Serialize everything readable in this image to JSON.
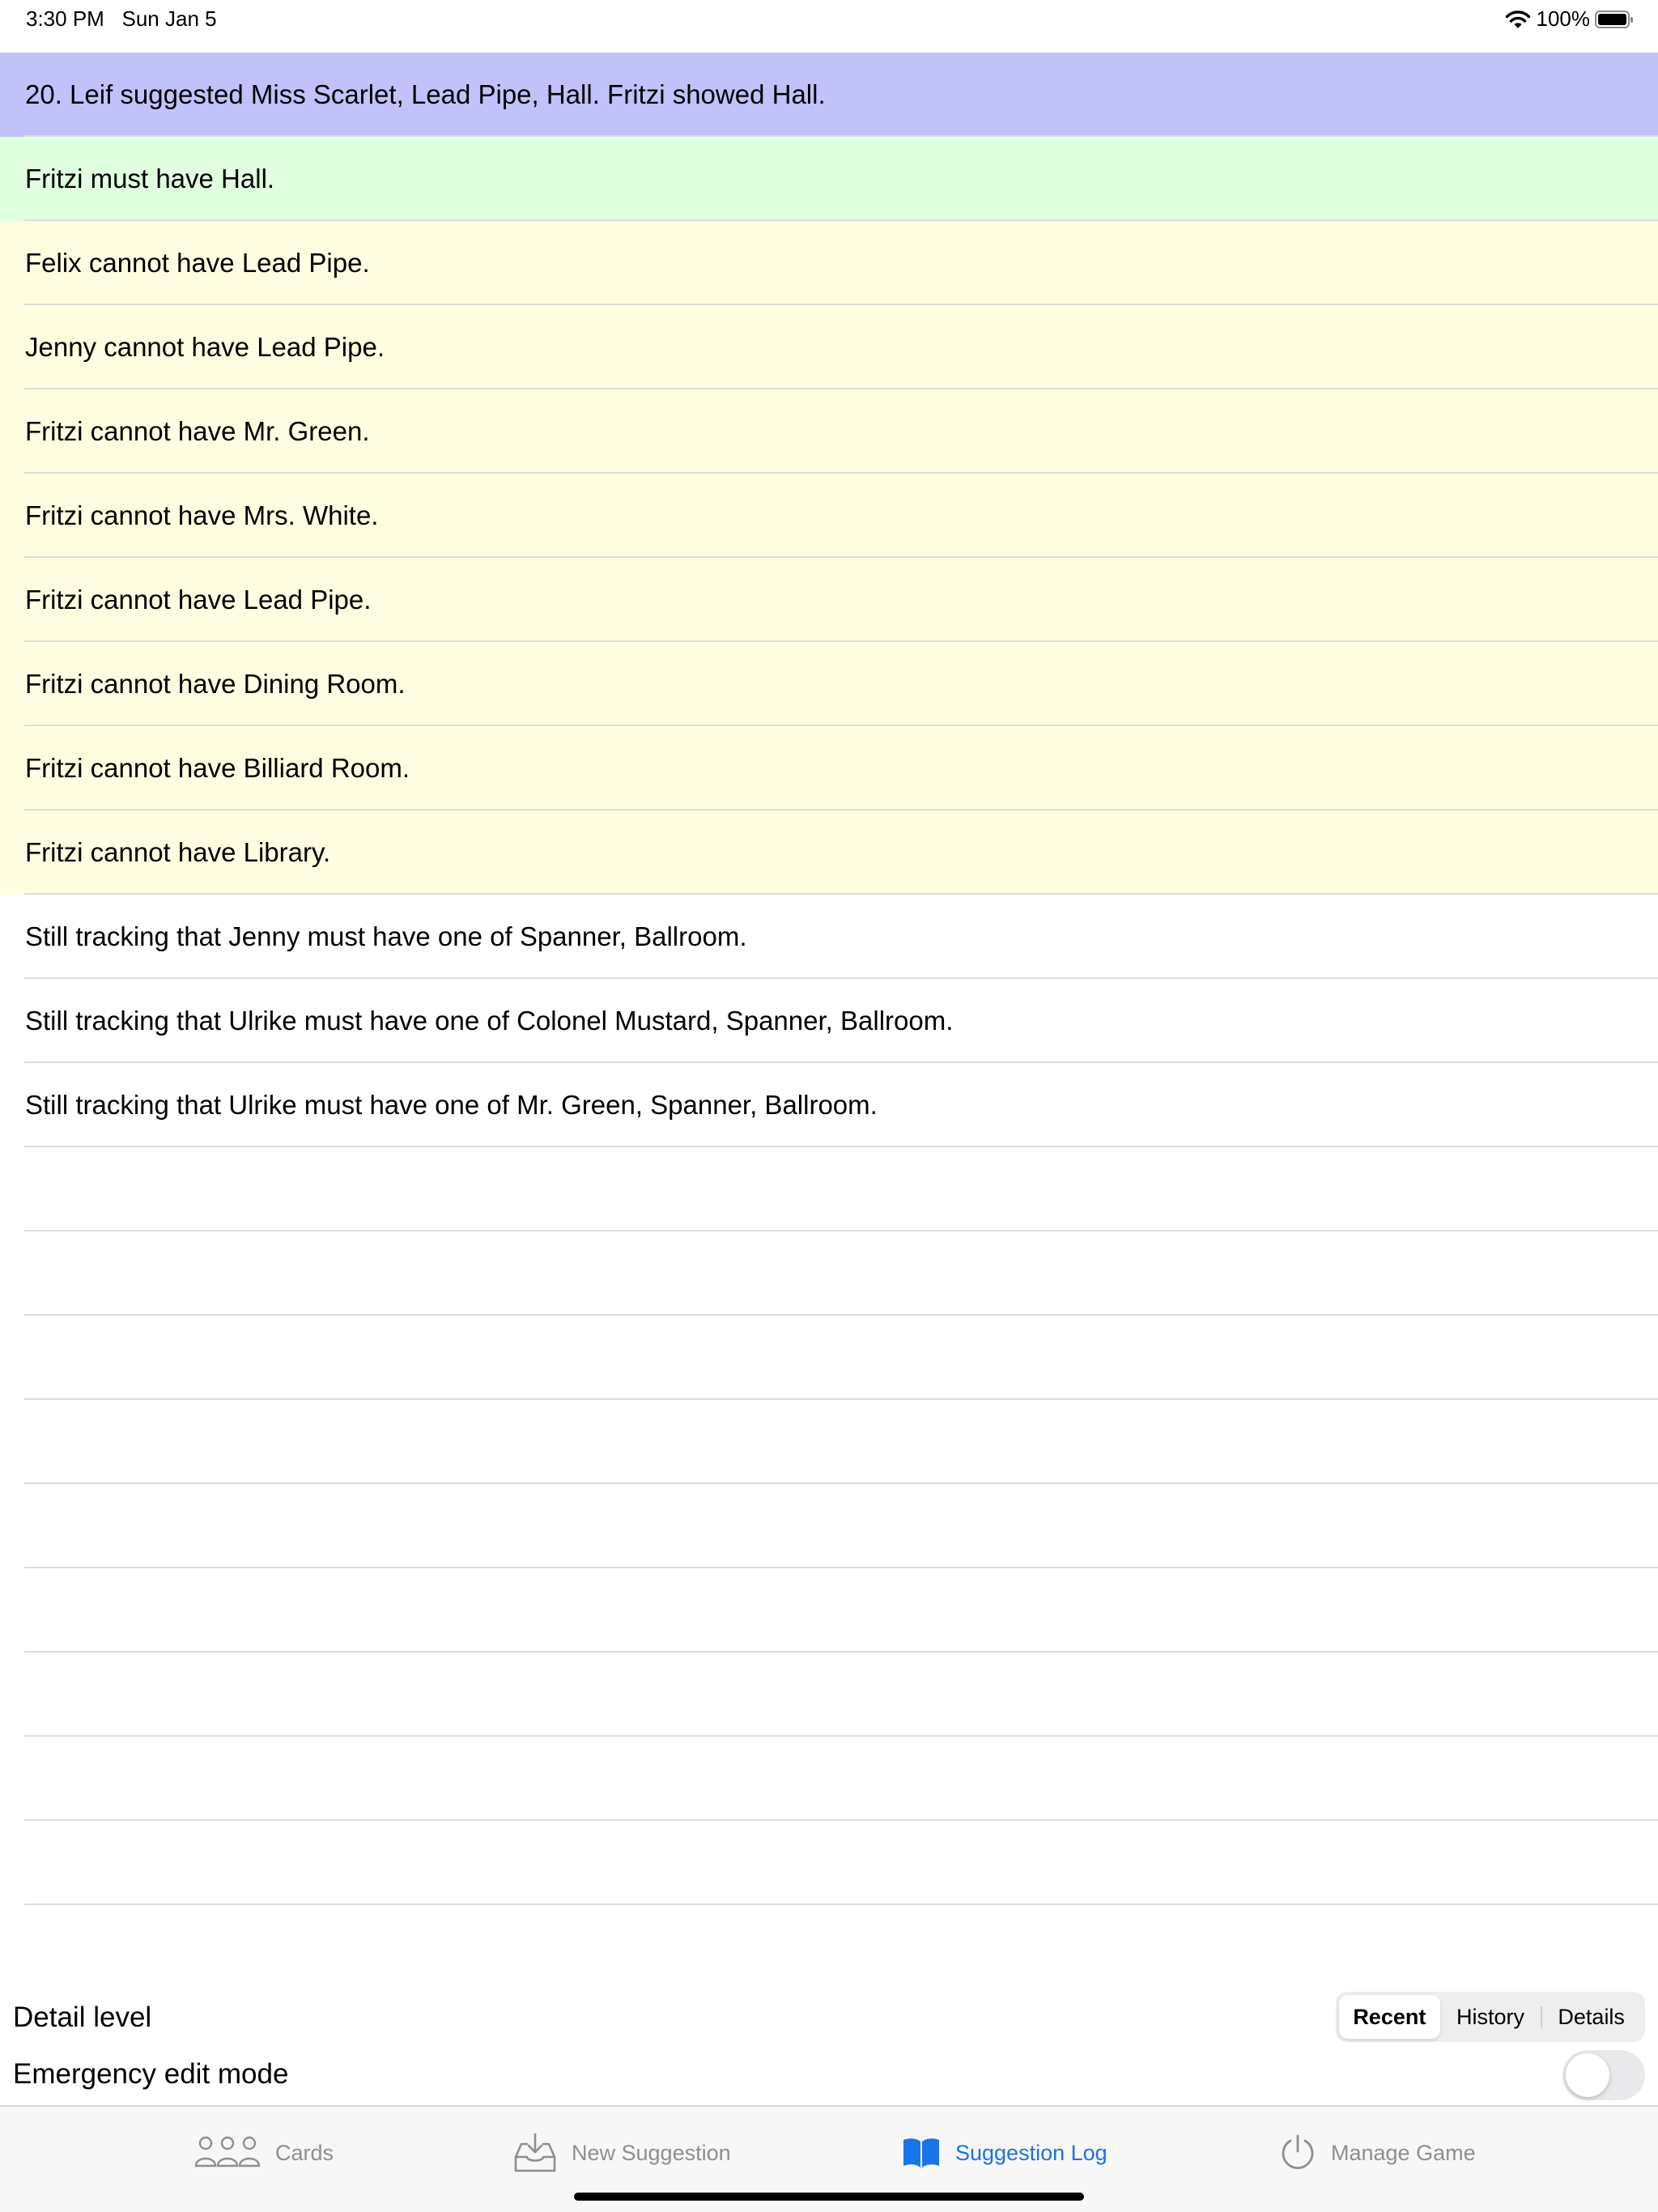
{
  "status_bar": {
    "time": "3:30 PM",
    "date": "Sun Jan 5",
    "battery_percent": "100%"
  },
  "log": {
    "suggestion": "20. Leif suggested Miss Scarlet, Lead Pipe, Hall. Fritzi showed Hall.",
    "must": [
      "Fritzi must have Hall."
    ],
    "cannot": [
      "Felix cannot have Lead Pipe.",
      "Jenny cannot have Lead Pipe.",
      "Fritzi cannot have Mr. Green.",
      "Fritzi cannot have Mrs. White.",
      "Fritzi cannot have Lead Pipe.",
      "Fritzi cannot have Dining Room.",
      "Fritzi cannot have Billiard Room.",
      "Fritzi cannot have Library."
    ],
    "tracking": [
      "Still tracking that Jenny must have one of Spanner, Ballroom.",
      "Still tracking that Ulrike must have one of Colonel Mustard, Spanner, Ballroom.",
      "Still tracking that Ulrike must have one of Mr. Green, Spanner, Ballroom."
    ]
  },
  "detail_level": {
    "label": "Detail level",
    "options": [
      "Recent",
      "History",
      "Details"
    ],
    "selected": "Recent"
  },
  "emergency_edit": {
    "label": "Emergency edit mode",
    "enabled": false
  },
  "tabs": [
    {
      "label": "Cards",
      "icon": "people-icon",
      "active": false
    },
    {
      "label": "New Suggestion",
      "icon": "inbox-download-icon",
      "active": false
    },
    {
      "label": "Suggestion Log",
      "icon": "book-icon",
      "active": true
    },
    {
      "label": "Manage Game",
      "icon": "power-icon",
      "active": false
    }
  ],
  "colors": {
    "suggestion_row": "#c2c2fb",
    "must_row": "#dfffdf",
    "cannot_row": "#fffddf",
    "active_tab": "#1a73e8"
  }
}
